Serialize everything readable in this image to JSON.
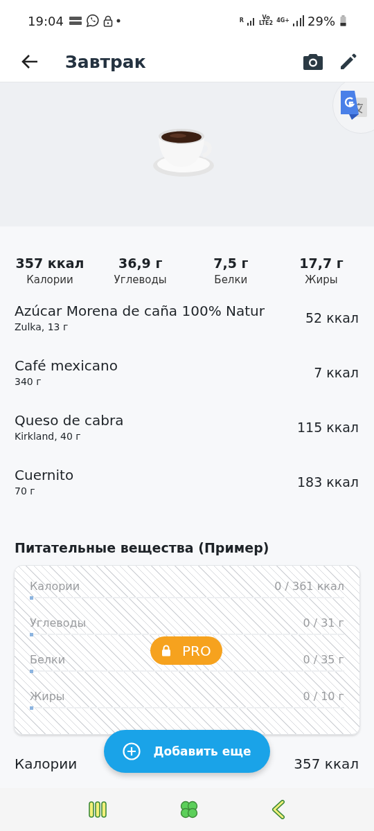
{
  "status_bar": {
    "time": "19:04",
    "network_labels": [
      "R",
      "Vo",
      "LTE2",
      "4G+"
    ],
    "battery": "29%"
  },
  "app_bar": {
    "title": "Завтрак"
  },
  "summary": [
    {
      "value": "357 ккал",
      "label": "Калории"
    },
    {
      "value": "36,9 г",
      "label": "Углеводы"
    },
    {
      "value": "7,5 г",
      "label": "Белки"
    },
    {
      "value": "17,7 г",
      "label": "Жиры"
    }
  ],
  "foods": [
    {
      "name": "Azúcar Morena de caña 100% Natur",
      "detail": "Zulka, 13 г",
      "calories": "52 ккал"
    },
    {
      "name": "Café mexicano",
      "detail": "340 г",
      "calories": "7 ккал"
    },
    {
      "name": "Queso de cabra",
      "detail": "Kirkland, 40 г",
      "calories": "115 ккал"
    },
    {
      "name": "Cuernito",
      "detail": "70 г",
      "calories": "183 ккал"
    }
  ],
  "nutrients": {
    "title": "Питательные вещества (Пример)",
    "locked_badge": "PRO",
    "rows": [
      {
        "name": "Калории",
        "reading": "0 / 361 ккал",
        "level": 0
      },
      {
        "name": "Углеводы",
        "reading": "0 / 31 г",
        "level": 0
      },
      {
        "name": "Белки",
        "reading": "0 / 35 г",
        "level": 0
      },
      {
        "name": "Жиры",
        "reading": "0 / 10 г",
        "level": 0
      }
    ]
  },
  "add_button": "Добавить еще",
  "total": {
    "label": "Калории",
    "value": "357 ккал"
  }
}
